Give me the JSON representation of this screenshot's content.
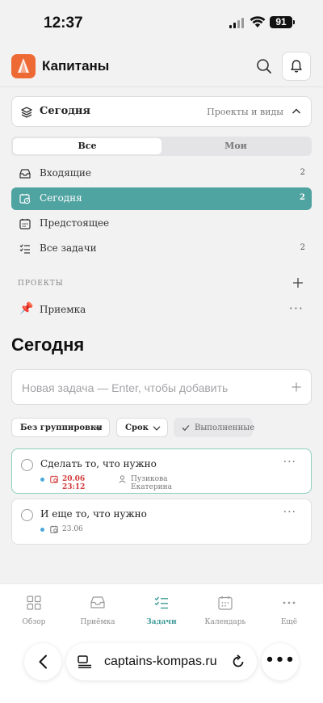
{
  "status_bar": {
    "time": "12:37",
    "battery": "91"
  },
  "header": {
    "app_title": "Капитаны"
  },
  "project_selector": {
    "label": "Сегодня",
    "right_label": "Проекты и виды"
  },
  "segment": {
    "all": "Все",
    "mine": "Мои"
  },
  "nav": [
    {
      "label": "Входящие",
      "count": "2"
    },
    {
      "label": "Сегодня",
      "count": "2"
    },
    {
      "label": "Предстоящее",
      "count": ""
    },
    {
      "label": "Все задачи",
      "count": "2"
    }
  ],
  "projects_section": {
    "title": "ПРОЕКТЫ",
    "items": [
      {
        "label": "Приемка"
      }
    ]
  },
  "page_title": "Сегодня",
  "new_task": {
    "placeholder": "Новая задача — Enter, чтобы добавить"
  },
  "filters": {
    "grouping": "Без группировки",
    "due": "Срок",
    "completed": "Выполненные"
  },
  "tasks": [
    {
      "title": "Сделать то, что нужно",
      "date": "20.06 23:12",
      "assignee": "Пузикова Екатерина",
      "overdue": true
    },
    {
      "title": "И еще то, что нужно",
      "date": "23.06",
      "assignee": "",
      "overdue": false
    }
  ],
  "bottom_nav": [
    {
      "label": "Обзор",
      "icon": "grid-icon"
    },
    {
      "label": "Приёмка",
      "icon": "inbox-icon"
    },
    {
      "label": "Задачи",
      "icon": "tasks-icon",
      "active": true
    },
    {
      "label": "Календарь",
      "icon": "calendar-icon"
    },
    {
      "label": "Ещё",
      "icon": "more-icon"
    }
  ],
  "browser": {
    "url": "captains-kompas.ru"
  },
  "colors": {
    "accent": "#4fa3a0",
    "logo": "#ee6a35",
    "overdue": "#d23a3a"
  }
}
